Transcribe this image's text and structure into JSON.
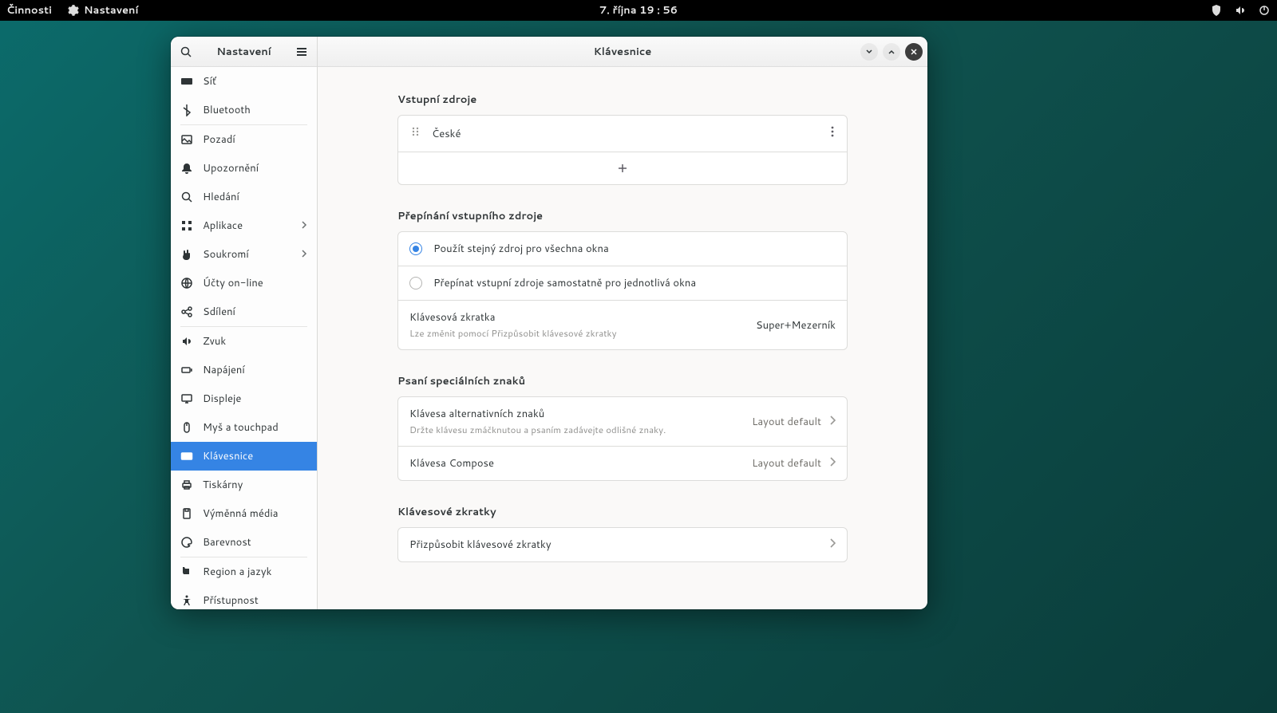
{
  "panel": {
    "activities": "Činnosti",
    "app_name": "Nastavení",
    "datetime": "7. října  19 : 56"
  },
  "sidebar": {
    "title": "Nastavení",
    "items": [
      {
        "label": "Síť",
        "icon": "network-icon"
      },
      {
        "label": "Bluetooth",
        "icon": "bluetooth-icon"
      },
      {
        "label": "Pozadí",
        "icon": "wallpaper-icon",
        "sepBefore": true
      },
      {
        "label": "Upozornění",
        "icon": "bell-icon"
      },
      {
        "label": "Hledání",
        "icon": "search-icon"
      },
      {
        "label": "Aplikace",
        "icon": "apps-icon",
        "chevron": true
      },
      {
        "label": "Soukromí",
        "icon": "hand-icon",
        "chevron": true
      },
      {
        "label": "Účty on-line",
        "icon": "online-accounts-icon"
      },
      {
        "label": "Sdílení",
        "icon": "share-icon"
      },
      {
        "label": "Zvuk",
        "icon": "sound-icon",
        "sepBefore": true
      },
      {
        "label": "Napájení",
        "icon": "power-icon"
      },
      {
        "label": "Displeje",
        "icon": "display-icon"
      },
      {
        "label": "Myš a touchpad",
        "icon": "mouse-icon"
      },
      {
        "label": "Klávesnice",
        "icon": "keyboard-icon",
        "active": true
      },
      {
        "label": "Tiskárny",
        "icon": "printer-icon"
      },
      {
        "label": "Výměnná média",
        "icon": "removable-media-icon"
      },
      {
        "label": "Barevnost",
        "icon": "color-icon"
      },
      {
        "label": "Region a jazyk",
        "icon": "region-icon",
        "sepBefore": true
      },
      {
        "label": "Přístupnost",
        "icon": "accessibility-icon"
      }
    ]
  },
  "main": {
    "title": "Klávesnice",
    "sections": {
      "input_sources": {
        "heading": "Vstupní zdroje",
        "items": [
          "České"
        ]
      },
      "switching": {
        "heading": "Přepínání vstupního zdroje",
        "options": [
          "Použít stejný zdroj pro všechna okna",
          "Přepínat vstupní zdroje samostatně pro jednotlivá okna"
        ],
        "selected": 0,
        "shortcut": {
          "label": "Klávesová zkratka",
          "sub": "Lze změnit pomocí Přizpůsobit klávesové zkratky",
          "value": "Super+Mezerník"
        }
      },
      "special_chars": {
        "heading": "Psaní speciálních znaků",
        "alt_key": {
          "label": "Klávesa alternativních znaků",
          "sub": "Držte klávesu zmáčknutou a psaním zadávejte odlišné znaky.",
          "value": "Layout default"
        },
        "compose_key": {
          "label": "Klávesa Compose",
          "value": "Layout default"
        }
      },
      "shortcuts": {
        "heading": "Klávesové zkratky",
        "customize": "Přizpůsobit klávesové zkratky"
      }
    }
  }
}
